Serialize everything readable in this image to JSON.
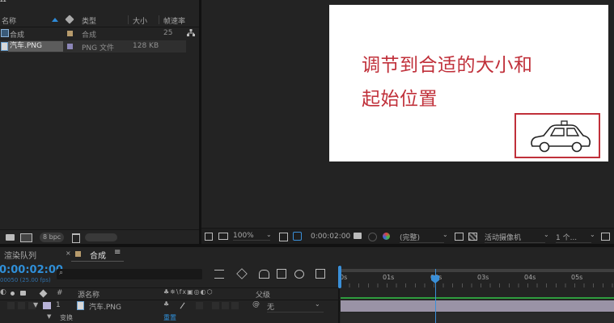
{
  "project": {
    "top_left_glyph": "Ω",
    "headers": {
      "name": "名称",
      "type": "类型",
      "size": "大小",
      "fps": "帧速率"
    },
    "items": [
      {
        "name": "合成",
        "type": "合成",
        "size": "",
        "fps": "25",
        "swatch": "#b79b6c"
      },
      {
        "name": "汽车.PNG",
        "type": "PNG 文件",
        "size": "128 KB",
        "fps": "",
        "swatch": "#8c86b8"
      }
    ],
    "footer": {
      "bpc": "8 bpc"
    }
  },
  "composition": {
    "caption_line1": "调节到合适的大小和",
    "caption_line2": "起始位置",
    "caption_color": "#c0303a",
    "border_color": "#c0303a"
  },
  "viewer_toolbar": {
    "zoom": "100%",
    "timecode": "0:00:02:00",
    "resolution": "(完整)",
    "camera": "活动摄像机",
    "views": "1 个..."
  },
  "timeline": {
    "tab_render": "渲染队列",
    "tab_comp": "合成",
    "current_time": "0:00:02:00",
    "frame_info": "00050 (25.00 fps)",
    "search_placeholder": "",
    "col_source": "源名称",
    "col_parent": "父级",
    "hash": "#",
    "layer": {
      "index": "1",
      "name": "汽车.PNG",
      "parent": "无",
      "label_color": "#b8b3d8"
    },
    "transform_label": "变换",
    "reset_label": "重置",
    "ruler": [
      "0s",
      "01s",
      "02s",
      "03s",
      "04s",
      "05s"
    ],
    "playhead_label": "02s"
  }
}
